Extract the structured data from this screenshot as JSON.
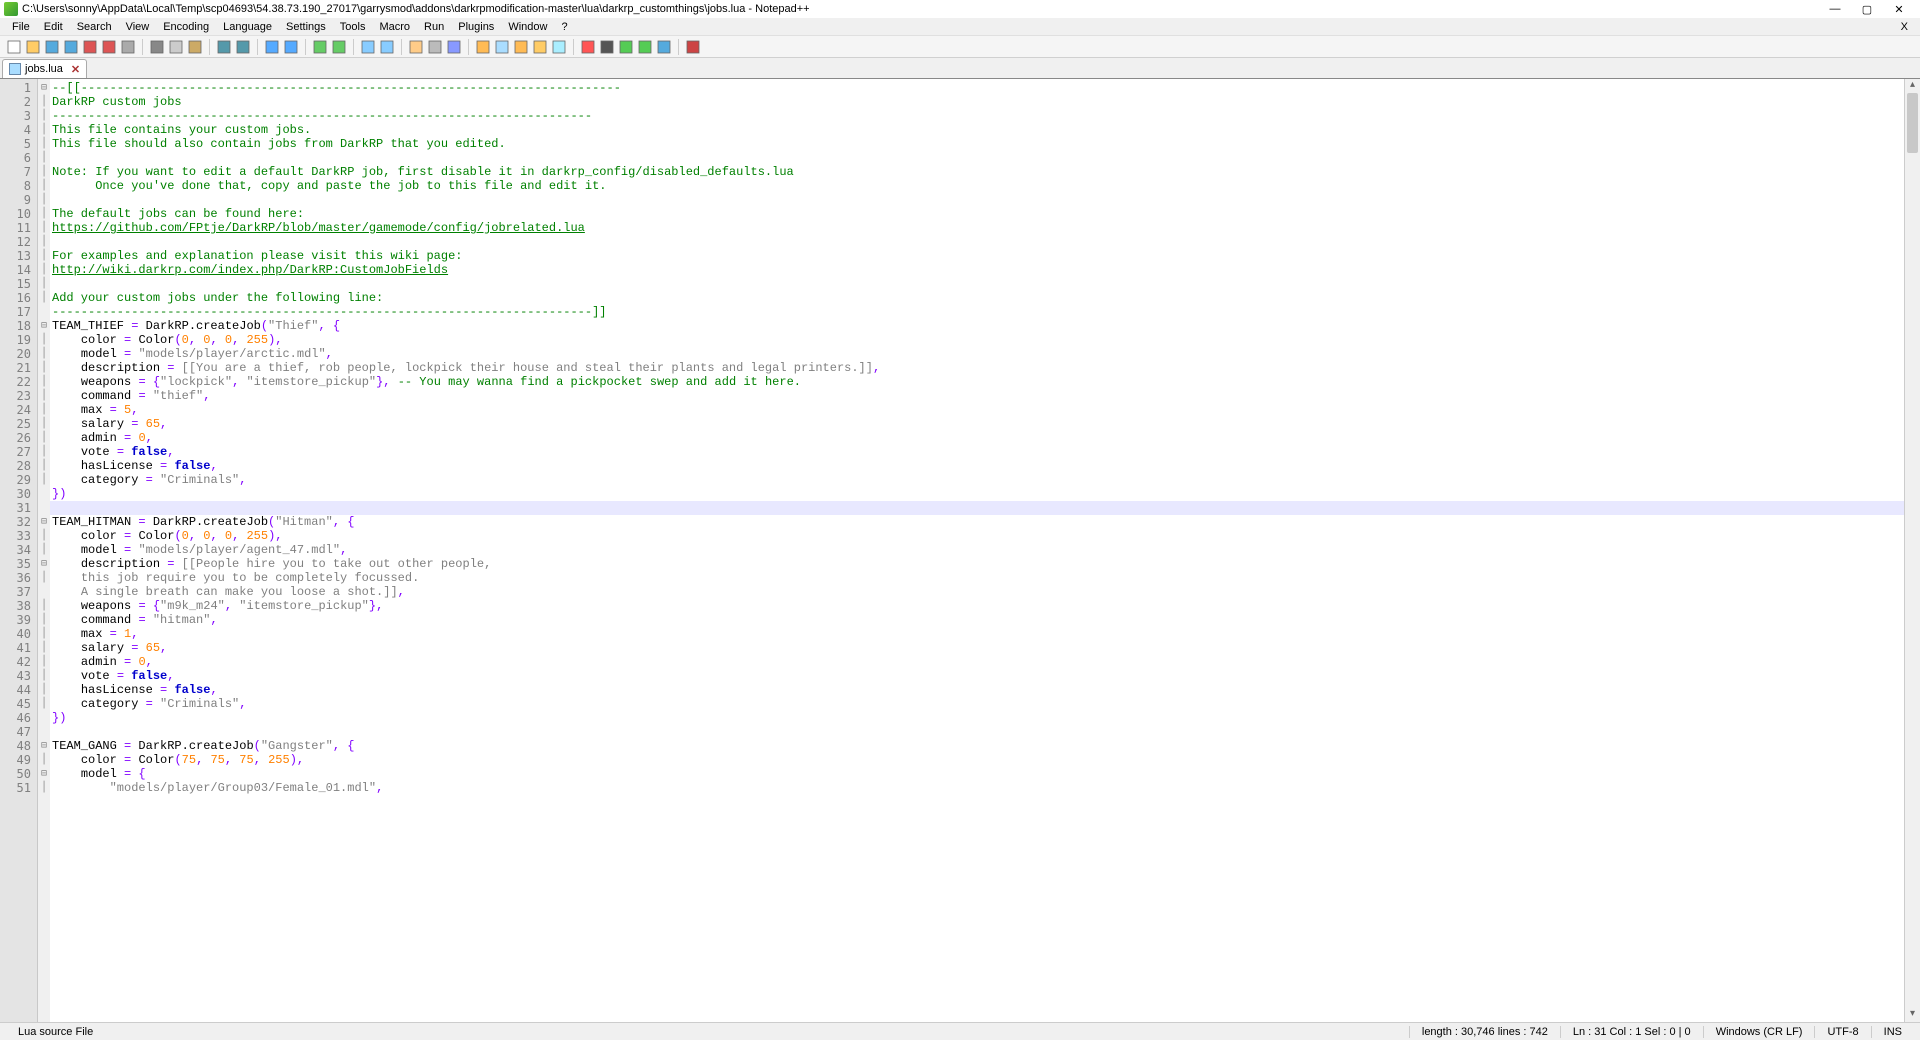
{
  "title_bar": {
    "path": "C:\\Users\\sonny\\AppData\\Local\\Temp\\scp04693\\54.38.73.190_27017\\garrysmod\\addons\\darkrpmodification-master\\lua\\darkrp_customthings\\jobs.lua - Notepad++"
  },
  "menu": [
    "File",
    "Edit",
    "Search",
    "View",
    "Encoding",
    "Language",
    "Settings",
    "Tools",
    "Macro",
    "Run",
    "Plugins",
    "Window",
    "?"
  ],
  "menu_x": "X",
  "tab": {
    "name": "jobs.lua",
    "close": "✕"
  },
  "code_lines": [
    {
      "n": 1,
      "fold": "⊟",
      "class": "",
      "html": "<span class='c-comment'>--[[---------------------------------------------------------------------------</span>"
    },
    {
      "n": 2,
      "fold": "|",
      "class": "",
      "html": "<span class='c-comment'>DarkRP custom jobs</span>"
    },
    {
      "n": 3,
      "fold": "|",
      "class": "",
      "html": "<span class='c-comment'>---------------------------------------------------------------------------</span>"
    },
    {
      "n": 4,
      "fold": "|",
      "class": "",
      "html": "<span class='c-comment'>This file contains your custom jobs.</span>"
    },
    {
      "n": 5,
      "fold": "|",
      "class": "",
      "html": "<span class='c-comment'>This file should also contain jobs from DarkRP that you edited.</span>"
    },
    {
      "n": 6,
      "fold": "|",
      "class": "",
      "html": ""
    },
    {
      "n": 7,
      "fold": "|",
      "class": "",
      "html": "<span class='c-comment'>Note: If you want to edit a default DarkRP job, first disable it in darkrp_config/disabled_defaults.lua</span>"
    },
    {
      "n": 8,
      "fold": "|",
      "class": "",
      "html": "<span class='c-comment'>      Once you've done that, copy and paste the job to this file and edit it.</span>"
    },
    {
      "n": 9,
      "fold": "|",
      "class": "",
      "html": ""
    },
    {
      "n": 10,
      "fold": "|",
      "class": "",
      "html": "<span class='c-comment'>The default jobs can be found here:</span>"
    },
    {
      "n": 11,
      "fold": "|",
      "class": "",
      "html": "<span class='c-link'>https://github.com/FPtje/DarkRP/blob/master/gamemode/config/jobrelated.lua</span>"
    },
    {
      "n": 12,
      "fold": "|",
      "class": "",
      "html": ""
    },
    {
      "n": 13,
      "fold": "|",
      "class": "",
      "html": "<span class='c-comment'>For examples and explanation please visit this wiki page:</span>"
    },
    {
      "n": 14,
      "fold": "|",
      "class": "",
      "html": "<span class='c-link'>http://wiki.darkrp.com/index.php/DarkRP:CustomJobFields</span>"
    },
    {
      "n": 15,
      "fold": "|",
      "class": "",
      "html": ""
    },
    {
      "n": 16,
      "fold": "|",
      "class": "",
      "html": "<span class='c-comment'>Add your custom jobs under the following line:</span>"
    },
    {
      "n": 17,
      "fold": "",
      "class": "",
      "html": "<span class='c-comment'>---------------------------------------------------------------------------]]</span>"
    },
    {
      "n": 18,
      "fold": "⊟",
      "class": "",
      "html": "<span class='c-id'>TEAM_THIEF</span> <span class='c-op'>=</span> <span class='c-id'>DarkRP.createJob</span><span class='c-op'>(</span><span class='c-str'>\"Thief\"</span><span class='c-op'>, {</span>"
    },
    {
      "n": 19,
      "fold": "|",
      "class": "",
      "html": "    <span class='c-id'>color</span> <span class='c-op'>=</span> <span class='c-id'>Color</span><span class='c-op'>(</span><span class='c-num'>0</span><span class='c-op'>,</span> <span class='c-num'>0</span><span class='c-op'>,</span> <span class='c-num'>0</span><span class='c-op'>,</span> <span class='c-num'>255</span><span class='c-op'>),</span>"
    },
    {
      "n": 20,
      "fold": "|",
      "class": "",
      "html": "    <span class='c-id'>model</span> <span class='c-op'>=</span> <span class='c-str'>\"models/player/arctic.mdl\"</span><span class='c-op'>,</span>"
    },
    {
      "n": 21,
      "fold": "|",
      "class": "",
      "html": "    <span class='c-id'>description</span> <span class='c-op'>=</span> <span class='c-str'>[[You are a thief, rob people, lockpick their house and steal their plants and legal printers.]]</span><span class='c-op'>,</span>"
    },
    {
      "n": 22,
      "fold": "|",
      "class": "",
      "html": "    <span class='c-id'>weapons</span> <span class='c-op'>= {</span><span class='c-str'>\"lockpick\"</span><span class='c-op'>,</span> <span class='c-str'>\"itemstore_pickup\"</span><span class='c-op'>},</span> <span class='c-comment'>-- You may wanna find a pickpocket swep and add it here.</span>"
    },
    {
      "n": 23,
      "fold": "|",
      "class": "",
      "html": "    <span class='c-id'>command</span> <span class='c-op'>=</span> <span class='c-str'>\"thief\"</span><span class='c-op'>,</span>"
    },
    {
      "n": 24,
      "fold": "|",
      "class": "",
      "html": "    <span class='c-id'>max</span> <span class='c-op'>=</span> <span class='c-num'>5</span><span class='c-op'>,</span>"
    },
    {
      "n": 25,
      "fold": "|",
      "class": "",
      "html": "    <span class='c-id'>salary</span> <span class='c-op'>=</span> <span class='c-num'>65</span><span class='c-op'>,</span>"
    },
    {
      "n": 26,
      "fold": "|",
      "class": "",
      "html": "    <span class='c-id'>admin</span> <span class='c-op'>=</span> <span class='c-num'>0</span><span class='c-op'>,</span>"
    },
    {
      "n": 27,
      "fold": "|",
      "class": "",
      "html": "    <span class='c-id'>vote</span> <span class='c-op'>=</span> <span class='c-kw'>false</span><span class='c-op'>,</span>"
    },
    {
      "n": 28,
      "fold": "|",
      "class": "",
      "html": "    <span class='c-id'>hasLicense</span> <span class='c-op'>=</span> <span class='c-kw'>false</span><span class='c-op'>,</span>"
    },
    {
      "n": 29,
      "fold": "|",
      "class": "",
      "html": "    <span class='c-id'>category</span> <span class='c-op'>=</span> <span class='c-str'>\"Criminals\"</span><span class='c-op'>,</span>"
    },
    {
      "n": 30,
      "fold": "",
      "class": "",
      "html": "<span class='c-op'>})</span>"
    },
    {
      "n": 31,
      "fold": "",
      "class": "current",
      "html": ""
    },
    {
      "n": 32,
      "fold": "⊟",
      "class": "",
      "html": "<span class='c-id'>TEAM_HITMAN</span> <span class='c-op'>=</span> <span class='c-id'>DarkRP.createJob</span><span class='c-op'>(</span><span class='c-str'>\"Hitman\"</span><span class='c-op'>, {</span>"
    },
    {
      "n": 33,
      "fold": "|",
      "class": "",
      "html": "    <span class='c-id'>color</span> <span class='c-op'>=</span> <span class='c-id'>Color</span><span class='c-op'>(</span><span class='c-num'>0</span><span class='c-op'>,</span> <span class='c-num'>0</span><span class='c-op'>,</span> <span class='c-num'>0</span><span class='c-op'>,</span> <span class='c-num'>255</span><span class='c-op'>),</span>"
    },
    {
      "n": 34,
      "fold": "|",
      "class": "",
      "html": "    <span class='c-id'>model</span> <span class='c-op'>=</span> <span class='c-str'>\"models/player/agent_47.mdl\"</span><span class='c-op'>,</span>"
    },
    {
      "n": 35,
      "fold": "⊟",
      "class": "",
      "html": "    <span class='c-id'>description</span> <span class='c-op'>=</span> <span class='c-str'>[[People hire you to take out other people,</span>"
    },
    {
      "n": 36,
      "fold": "|",
      "class": "",
      "html": "    <span class='c-str'>this job require you to be completely focussed.</span>"
    },
    {
      "n": 37,
      "fold": "",
      "class": "",
      "html": "    <span class='c-str'>A single breath can make you loose a shot.]]</span><span class='c-op'>,</span>"
    },
    {
      "n": 38,
      "fold": "|",
      "class": "",
      "html": "    <span class='c-id'>weapons</span> <span class='c-op'>= {</span><span class='c-str'>\"m9k_m24\"</span><span class='c-op'>,</span> <span class='c-str'>\"itemstore_pickup\"</span><span class='c-op'>},</span>"
    },
    {
      "n": 39,
      "fold": "|",
      "class": "",
      "html": "    <span class='c-id'>command</span> <span class='c-op'>=</span> <span class='c-str'>\"hitman\"</span><span class='c-op'>,</span>"
    },
    {
      "n": 40,
      "fold": "|",
      "class": "",
      "html": "    <span class='c-id'>max</span> <span class='c-op'>=</span> <span class='c-num'>1</span><span class='c-op'>,</span>"
    },
    {
      "n": 41,
      "fold": "|",
      "class": "",
      "html": "    <span class='c-id'>salary</span> <span class='c-op'>=</span> <span class='c-num'>65</span><span class='c-op'>,</span>"
    },
    {
      "n": 42,
      "fold": "|",
      "class": "",
      "html": "    <span class='c-id'>admin</span> <span class='c-op'>=</span> <span class='c-num'>0</span><span class='c-op'>,</span>"
    },
    {
      "n": 43,
      "fold": "|",
      "class": "",
      "html": "    <span class='c-id'>vote</span> <span class='c-op'>=</span> <span class='c-kw'>false</span><span class='c-op'>,</span>"
    },
    {
      "n": 44,
      "fold": "|",
      "class": "",
      "html": "    <span class='c-id'>hasLicense</span> <span class='c-op'>=</span> <span class='c-kw'>false</span><span class='c-op'>,</span>"
    },
    {
      "n": 45,
      "fold": "|",
      "class": "",
      "html": "    <span class='c-id'>category</span> <span class='c-op'>=</span> <span class='c-str'>\"Criminals\"</span><span class='c-op'>,</span>"
    },
    {
      "n": 46,
      "fold": "",
      "class": "",
      "html": "<span class='c-op'>})</span>"
    },
    {
      "n": 47,
      "fold": "",
      "class": "",
      "html": ""
    },
    {
      "n": 48,
      "fold": "⊟",
      "class": "",
      "html": "<span class='c-id'>TEAM_GANG</span> <span class='c-op'>=</span> <span class='c-id'>DarkRP.createJob</span><span class='c-op'>(</span><span class='c-str'>\"Gangster\"</span><span class='c-op'>, {</span>"
    },
    {
      "n": 49,
      "fold": "|",
      "class": "",
      "html": "    <span class='c-id'>color</span> <span class='c-op'>=</span> <span class='c-id'>Color</span><span class='c-op'>(</span><span class='c-num'>75</span><span class='c-op'>,</span> <span class='c-num'>75</span><span class='c-op'>,</span> <span class='c-num'>75</span><span class='c-op'>,</span> <span class='c-num'>255</span><span class='c-op'>),</span>"
    },
    {
      "n": 50,
      "fold": "⊟",
      "class": "",
      "html": "    <span class='c-id'>model</span> <span class='c-op'>= {</span>"
    },
    {
      "n": 51,
      "fold": "|",
      "class": "",
      "html": "        <span class='c-str'>\"models/player/Group03/Female_01.mdl\"</span><span class='c-op'>,</span>"
    }
  ],
  "status": {
    "left": "Lua source File",
    "length": "length : 30,746    lines : 742",
    "pos": "Ln : 31    Col : 1    Sel : 0 | 0",
    "eol": "Windows (CR LF)",
    "enc": "UTF-8",
    "mode": "INS"
  },
  "toolbar_icons": [
    "new-file-icon",
    "open-file-icon",
    "save-icon",
    "save-all-icon",
    "close-icon",
    "close-all-icon",
    "print-icon",
    "|",
    "cut-icon",
    "copy-icon",
    "paste-icon",
    "|",
    "undo-icon",
    "redo-icon",
    "|",
    "find-icon",
    "replace-icon",
    "|",
    "zoom-in-icon",
    "zoom-out-icon",
    "|",
    "sync-v-icon",
    "sync-h-icon",
    "|",
    "wrap-icon",
    "show-all-icon",
    "indent-guide-icon",
    "|",
    "lang-icon",
    "doc-map-icon",
    "func-list-icon",
    "folder-icon",
    "monitor-icon",
    "|",
    "record-icon",
    "stop-icon",
    "play-icon",
    "play-mult-icon",
    "save-macro-icon",
    "|",
    "spell-icon"
  ]
}
